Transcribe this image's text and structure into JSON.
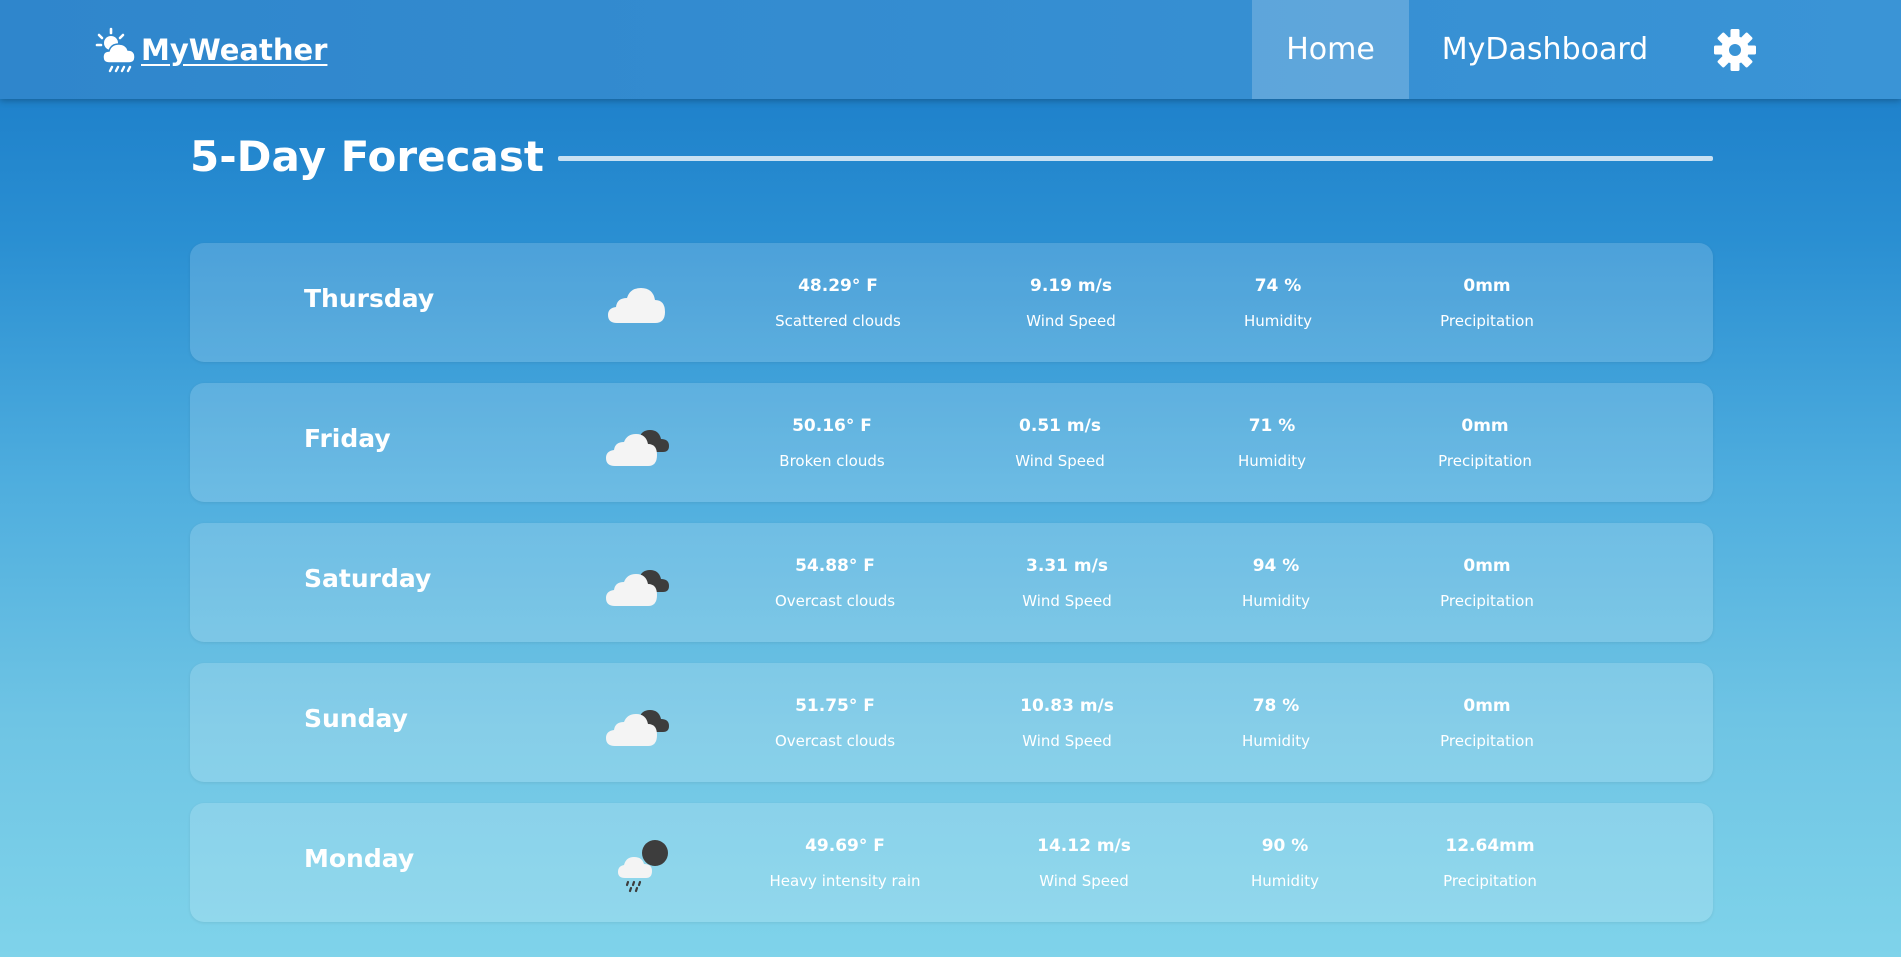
{
  "app": {
    "brand": "MyWeather",
    "nav": {
      "home": "Home",
      "dashboard": "MyDashboard"
    },
    "icons": {
      "brand": "sun-cloud-rain-icon",
      "settings": "gear-icon"
    }
  },
  "forecast": {
    "title": "5-Day Forecast",
    "days": [
      {
        "day": "Thursday",
        "icon": "scattered-clouds-icon",
        "temp": "48.29° F",
        "desc": "Scattered clouds",
        "wind": "9.19 m/s",
        "wind_label": "Wind Speed",
        "humidity": "74 %",
        "humidity_label": "Humidity",
        "precip": "0mm",
        "precip_label": "Precipitation"
      },
      {
        "day": "Friday",
        "icon": "broken-clouds-icon",
        "temp": "50.16° F",
        "desc": "Broken clouds",
        "wind": "0.51 m/s",
        "wind_label": "Wind Speed",
        "humidity": "71 %",
        "humidity_label": "Humidity",
        "precip": "0mm",
        "precip_label": "Precipitation"
      },
      {
        "day": "Saturday",
        "icon": "overcast-clouds-icon",
        "temp": "54.88° F",
        "desc": "Overcast clouds",
        "wind": "3.31 m/s",
        "wind_label": "Wind Speed",
        "humidity": "94 %",
        "humidity_label": "Humidity",
        "precip": "0mm",
        "precip_label": "Precipitation"
      },
      {
        "day": "Sunday",
        "icon": "overcast-clouds-icon",
        "temp": "51.75° F",
        "desc": "Overcast clouds",
        "wind": "10.83 m/s",
        "wind_label": "Wind Speed",
        "humidity": "78 %",
        "humidity_label": "Humidity",
        "precip": "0mm",
        "precip_label": "Precipitation"
      },
      {
        "day": "Monday",
        "icon": "rain-cloud-icon",
        "temp": "49.69° F",
        "desc": "Heavy intensity rain",
        "wind": "14.12 m/s",
        "wind_label": "Wind Speed",
        "humidity": "90 %",
        "humidity_label": "Humidity",
        "precip": "12.64mm",
        "precip_label": "Precipitation"
      }
    ]
  },
  "colors": {
    "nav_bg": "#2f86cc",
    "bg_top": "#1778c6",
    "bg_bottom": "#7fd3ea",
    "text": "#ffffff",
    "dark_cloud": "#3d3d3d"
  }
}
